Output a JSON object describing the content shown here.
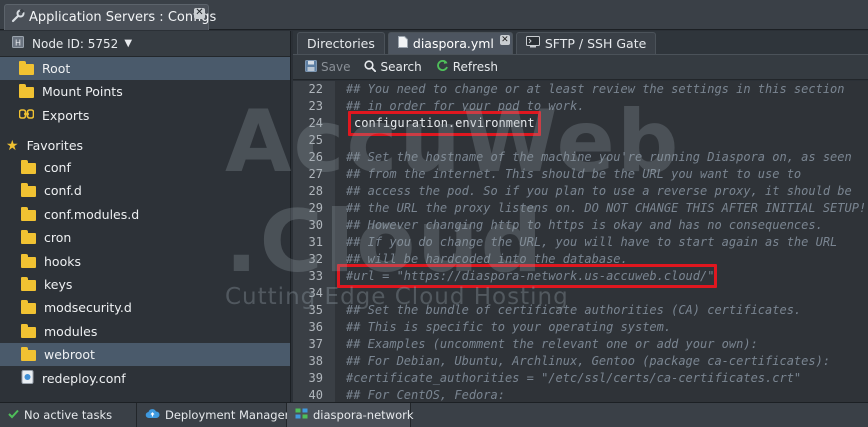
{
  "window": {
    "title": "Application Servers : Configs",
    "close_glyph": "✕"
  },
  "node": {
    "label": "Node ID: 5752"
  },
  "tree": [
    {
      "label": "Root",
      "icon": "folder-icon",
      "selected": true
    },
    {
      "label": "Mount Points",
      "icon": "folder-icon",
      "selected": false
    },
    {
      "label": "Exports",
      "icon": "exports-icon",
      "selected": false
    },
    {
      "label": "Favorites",
      "icon": "star-icon",
      "selected": false
    },
    {
      "label": "conf",
      "icon": "folder-icon",
      "selected": false
    },
    {
      "label": "conf.d",
      "icon": "folder-icon",
      "selected": false
    },
    {
      "label": "conf.modules.d",
      "icon": "folder-icon",
      "selected": false
    },
    {
      "label": "cron",
      "icon": "folder-icon",
      "selected": false
    },
    {
      "label": "hooks",
      "icon": "folder-icon",
      "selected": false
    },
    {
      "label": "keys",
      "icon": "folder-icon",
      "selected": false
    },
    {
      "label": "modsecurity.d",
      "icon": "folder-icon",
      "selected": false
    },
    {
      "label": "modules",
      "icon": "folder-icon",
      "selected": false
    },
    {
      "label": "webroot",
      "icon": "folder-icon",
      "selected": true
    },
    {
      "label": "redeploy.conf",
      "icon": "file-icon",
      "selected": false
    }
  ],
  "tabs": [
    {
      "label": "Directories",
      "active": false
    },
    {
      "label": "diaspora.yml",
      "active": true
    },
    {
      "label": "SFTP / SSH Gate",
      "active": false
    }
  ],
  "toolbar": {
    "save_label": "Save",
    "search_label": "Search",
    "refresh_label": "Refresh"
  },
  "editor": {
    "lines": [
      {
        "n": "22",
        "text": "## You need to change or at least review the settings in this section"
      },
      {
        "n": "23",
        "text": "## in order for your pod to work."
      },
      {
        "n": "24",
        "text": "configuration.environment"
      },
      {
        "n": "25",
        "text": ""
      },
      {
        "n": "26",
        "text": "## Set the hostname of the machine you're running Diaspora on, as seen"
      },
      {
        "n": "27",
        "text": "## from the internet. This should be the URL you want to use to"
      },
      {
        "n": "28",
        "text": "## access the pod. So if you plan to use a reverse proxy, it should be"
      },
      {
        "n": "29",
        "text": "## the URL the proxy listens on. DO NOT CHANGE THIS AFTER INITIAL SETUP!"
      },
      {
        "n": "30",
        "text": "## However changing http to https is okay and has no consequences."
      },
      {
        "n": "31",
        "text": "## If you do change the URL, you will have to start again as the URL"
      },
      {
        "n": "32",
        "text": "## will be hardcoded into the database."
      },
      {
        "n": "33",
        "text": "#url = \"https://diaspora-network.us-accuweb.cloud/\""
      },
      {
        "n": "34",
        "text": ""
      },
      {
        "n": "35",
        "text": "## Set the bundle of certificate authorities (CA) certificates."
      },
      {
        "n": "36",
        "text": "## This is specific to your operating system."
      },
      {
        "n": "37",
        "text": "## Examples (uncomment the relevant one or add your own):"
      },
      {
        "n": "38",
        "text": "## For Debian, Ubuntu, Archlinux, Gentoo (package ca-certificates):"
      },
      {
        "n": "39",
        "text": "#certificate_authorities = \"/etc/ssl/certs/ca-certificates.crt\""
      },
      {
        "n": "40",
        "text": "## For CentOS, Fedora:"
      }
    ]
  },
  "watermark": {
    "line1": "AccuWeb .Cloud",
    "line2": "Cutting Edge Cloud Hosting"
  },
  "statusbar": [
    {
      "label": "No active tasks",
      "icon": "check-icon"
    },
    {
      "label": "Deployment Manager",
      "icon": "cloud-icon"
    },
    {
      "label": "diaspora-network",
      "icon": "environment-icon"
    }
  ],
  "colors": {
    "highlight": "#e0171f",
    "folder": "#f1c232",
    "selection": "#4a5a6b"
  }
}
